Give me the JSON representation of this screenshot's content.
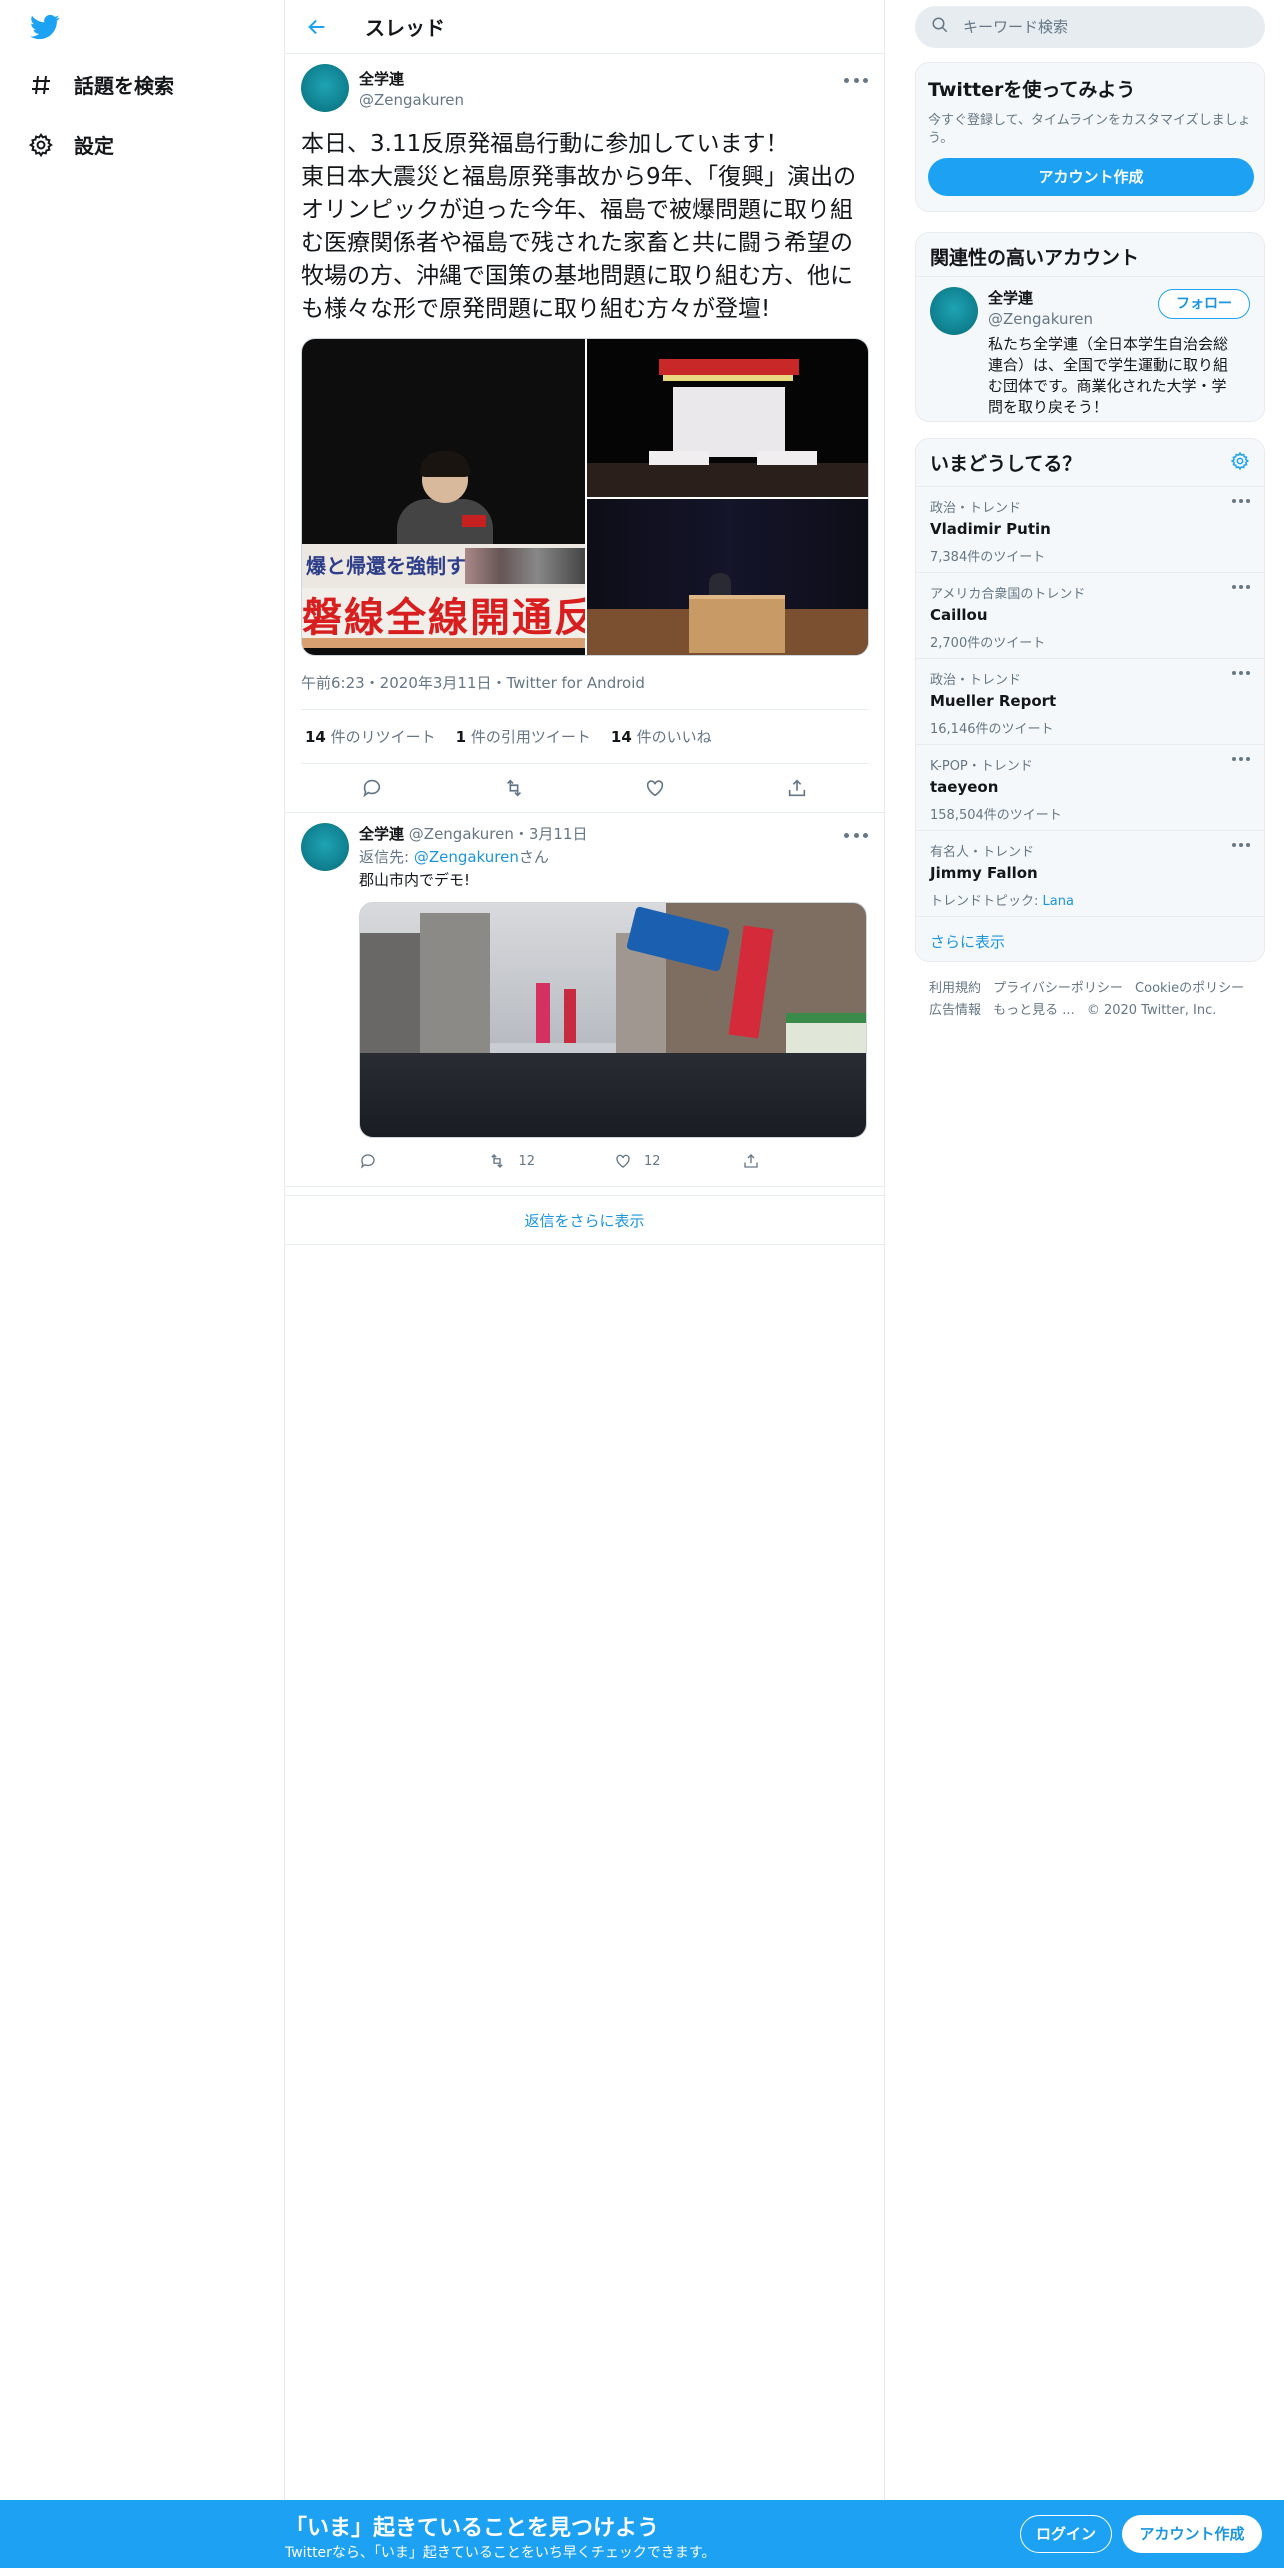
{
  "nav": {
    "explore_label": "話題を検索",
    "settings_label": "設定"
  },
  "header": {
    "title": "スレッド"
  },
  "main_tweet": {
    "name": "全学連",
    "handle": "@Zengakuren",
    "text": "本日、3.11反原発福島行動に参加しています！\n東日本大震災と福島原発事故から9年、「復興」演出のオリンピックが迫った今年、福島で被爆問題に取り組む医療関係者や福島で残された家畜と共に闘う希望の牧場の方、沖縄で国策の基地問題に取り組む方、他にも様々な形で原発問題に取り組む方々が登壇!",
    "image1_banner_top": "爆と帰還を強制する",
    "image1_banner_bottom": "磐線全線開通反",
    "meta": "午前6:23・2020年3月11日・Twitter for Android",
    "retweets_count": "14",
    "retweets_label": "件のリツイート",
    "quotes_count": "1",
    "quotes_label": "件の引用ツイート",
    "likes_count": "14",
    "likes_label": "件のいいね"
  },
  "reply": {
    "name": "全学連",
    "handle_date": "@Zengakuren・3月11日",
    "reply_to_prefix": "返信先: ",
    "reply_to_handle": "@Zengakuren",
    "reply_to_suffix": "さん",
    "text": "郡山市内でデモ!",
    "retweets": "12",
    "likes": "12"
  },
  "show_more_replies": "返信をさらに表示",
  "search": {
    "placeholder": "キーワード検索"
  },
  "signup_card": {
    "title": "Twitterを使ってみよう",
    "desc": "今すぐ登録して、タイムラインをカスタマイズしましょう。",
    "button": "アカウント作成"
  },
  "related": {
    "title": "関連性の高いアカウント",
    "name": "全学連",
    "handle": "@Zengakuren",
    "follow_label": "フォロー",
    "bio": "私たち全学連（全日本学生自治会総連合）は、全国で学生運動に取り組む団体です。商業化された大学・学問を取り戻そう！"
  },
  "trends": {
    "title": "いまどうしてる？",
    "items": [
      {
        "context": "政治・トレンド",
        "name": "Vladimir Putin",
        "count": "7,384件のツイート"
      },
      {
        "context": "アメリカ合衆国のトレンド",
        "name": "Caillou",
        "count": "2,700件のツイート"
      },
      {
        "context": "政治・トレンド",
        "name": "Mueller Report",
        "count": "16,146件のツイート"
      },
      {
        "context": "K-POP・トレンド",
        "name": "taeyeon",
        "count": "158,504件のツイート"
      },
      {
        "context": "有名人・トレンド",
        "name": "Jimmy Fallon",
        "count_prefix": "トレンドトピック: ",
        "count_link": "Lana"
      }
    ],
    "show_more": "さらに表示"
  },
  "footer": {
    "links": [
      "利用規約",
      "プライバシーポリシー",
      "Cookieのポリシー",
      "広告情報",
      "もっと見る ..."
    ],
    "copyright": "© 2020 Twitter, Inc."
  },
  "bottom_bar": {
    "title": "「いま」起きていることを見つけよう",
    "subtitle": "Twitterなら、「いま」起きていることをいち早くチェックできます。",
    "login": "ログイン",
    "signup": "アカウント作成"
  },
  "colors": {
    "accent": "#1da1f2",
    "link": "#1b95e0",
    "secondary_text": "#657786"
  }
}
